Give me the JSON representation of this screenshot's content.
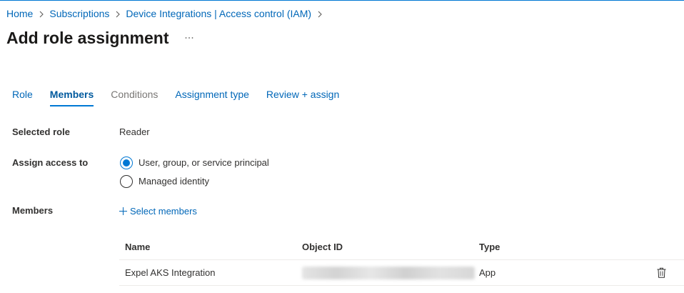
{
  "breadcrumb": [
    "Home",
    "Subscriptions",
    "Device Integrations | Access control (IAM)"
  ],
  "page": {
    "title": "Add role assignment"
  },
  "tabs": [
    {
      "label": "Role"
    },
    {
      "label": "Members",
      "selected": true
    },
    {
      "label": "Conditions",
      "disabled": true
    },
    {
      "label": "Assignment type"
    },
    {
      "label": "Review + assign"
    }
  ],
  "form": {
    "selected_role": {
      "label": "Selected role",
      "value": "Reader"
    },
    "assign_access_to": {
      "label": "Assign access to",
      "options": [
        {
          "label": "User, group, or service principal",
          "selected": true
        },
        {
          "label": "Managed identity",
          "selected": false
        }
      ]
    },
    "members": {
      "label": "Members",
      "select_link": "Select members"
    }
  },
  "members_table": {
    "columns": [
      "Name",
      "Object ID",
      "Type"
    ],
    "rows": [
      {
        "name": "Expel AKS Integration",
        "type": "App"
      }
    ]
  },
  "icons": {
    "breadcrumb_separator": "chevron-right-icon",
    "more": "more-icon",
    "add": "plus-icon",
    "remove": "trash-icon"
  },
  "colors": {
    "accent": "#0078d4",
    "link": "#0067b8",
    "text": "#323130",
    "disabled": "#797775"
  }
}
